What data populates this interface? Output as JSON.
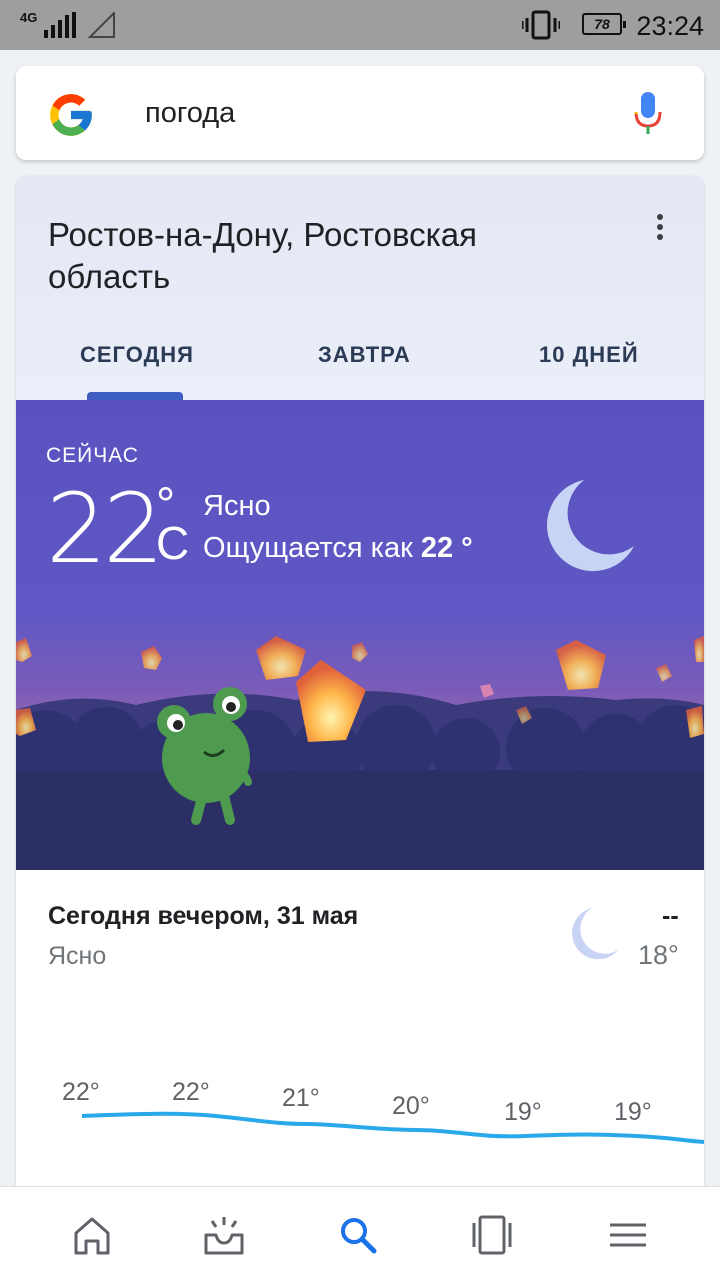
{
  "status_bar": {
    "network": "4G",
    "battery": "78",
    "time": "23:24",
    "icons": [
      "signal-icon",
      "no-sim-icon",
      "vibrate-icon",
      "battery-icon"
    ]
  },
  "search": {
    "query": "погода",
    "icons": [
      "google-logo",
      "mic-icon"
    ]
  },
  "weather": {
    "location": "Ростов-на-Дону, Ростовская область",
    "tabs": [
      {
        "label": "СЕГОДНЯ",
        "selected": true
      },
      {
        "label": "ЗАВТРА",
        "selected": false
      },
      {
        "label": "10 ДНЕЙ",
        "selected": false
      }
    ],
    "now": {
      "label": "СЕЙЧАС",
      "temp": "22",
      "degree": "°",
      "unit": "C",
      "condition": "Ясно",
      "feels_like_prefix": "Ощущается как",
      "feels_like_value": "22 °"
    },
    "tonight": {
      "title": "Сегодня вечером, 31 мая",
      "condition": "Ясно",
      "precip": "--",
      "low": "18°"
    },
    "hourly": [
      "22°",
      "22°",
      "21°",
      "20°",
      "19°",
      "19°"
    ],
    "colors": {
      "sky_top": "#5b55c2",
      "accent": "#3f5ec4",
      "graph_line": "#29a8ea"
    }
  },
  "bottom_nav": {
    "items": [
      "home-icon",
      "updates-icon",
      "search-icon",
      "recents-icon",
      "menu-icon"
    ],
    "active": "search-icon"
  }
}
